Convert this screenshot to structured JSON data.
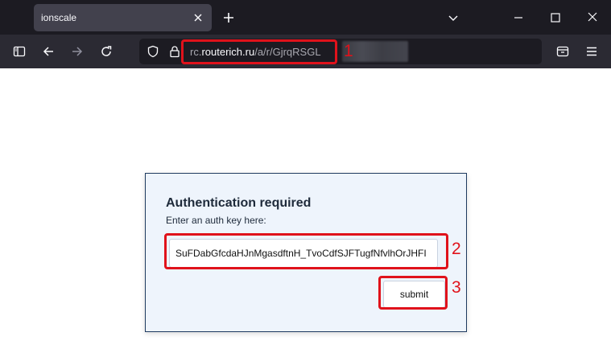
{
  "tab": {
    "title": "ionscale",
    "close_icon": "close-icon"
  },
  "toolbar": {
    "icons": [
      "sidebar-icon",
      "back-arrow-icon",
      "forward-arrow-icon",
      "reload-icon",
      "shield-icon",
      "lock-icon",
      "pocket-icon",
      "hamburger-menu-icon"
    ],
    "url": {
      "prefix": "rc.",
      "domain": "routerich.ru",
      "path": "/a/r/GjrqRSGL"
    }
  },
  "annotations": [
    {
      "number": "1",
      "color": "#e0121b"
    },
    {
      "number": "2",
      "color": "#e0121b"
    },
    {
      "number": "3",
      "color": "#e0121b"
    }
  ],
  "auth": {
    "title": "Authentication required",
    "subtitle": "Enter an auth key here:",
    "key_value": "SuFDabGfcdaHJnMgasdftnH_TvoCdfSJFTugfNfvlhOrJHFI",
    "submit_label": "submit"
  },
  "colors": {
    "tabbar_bg": "#1c1b22",
    "toolbar_bg": "#2b2a33",
    "card_bg": "#eef4fc",
    "card_border": "#1e3a5f",
    "annotation_red": "#e0121b"
  }
}
